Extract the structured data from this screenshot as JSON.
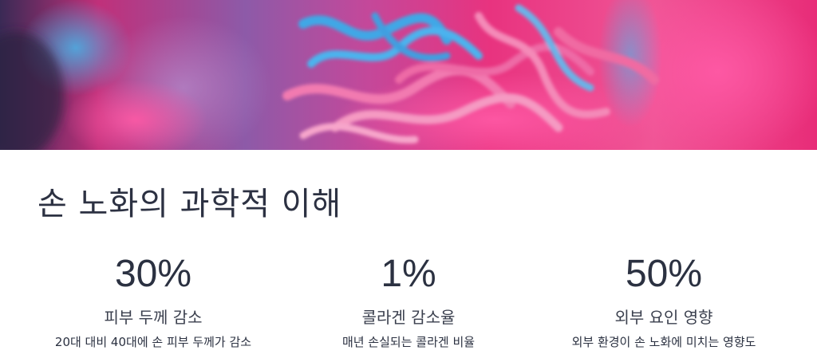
{
  "hero": {
    "image": "collagen-fibers-macro-photo",
    "colors": {
      "magenta": "#e8337f",
      "pink": "#f27ab0",
      "blue": "#3fa7e6",
      "purple": "#7a4a9a"
    }
  },
  "section": {
    "title": "손 노화의 과학적 이해"
  },
  "stats": [
    {
      "value": "30%",
      "label": "피부 두께 감소",
      "description": "20대 대비 40대에 손 피부 두께가 감소"
    },
    {
      "value": "1%",
      "label": "콜라겐 감소율",
      "description": "매년 손실되는 콜라겐 비율"
    },
    {
      "value": "50%",
      "label": "외부 요인 영향",
      "description": "외부 환경이 손 노화에 미치는 영향도"
    }
  ]
}
